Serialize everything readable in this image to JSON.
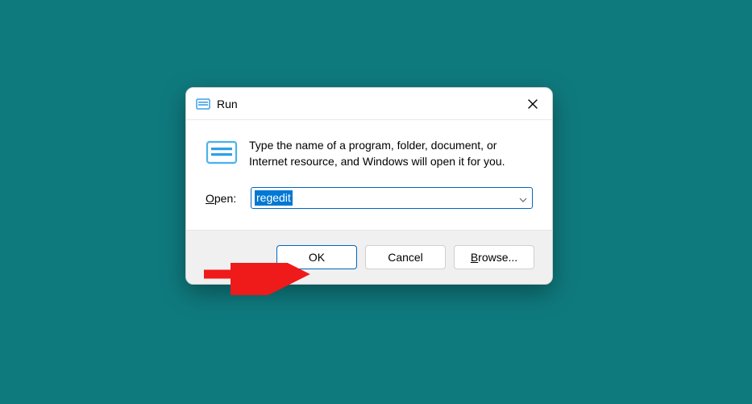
{
  "dialog": {
    "title": "Run",
    "description": "Type the name of a program, folder, document, or Internet resource, and Windows will open it for you.",
    "open_label_prefix_u": "O",
    "open_label_rest": "pen:",
    "input_value": "regedit",
    "buttons": {
      "ok": "OK",
      "cancel": "Cancel",
      "browse_prefix_u": "B",
      "browse_rest": "rowse..."
    }
  }
}
